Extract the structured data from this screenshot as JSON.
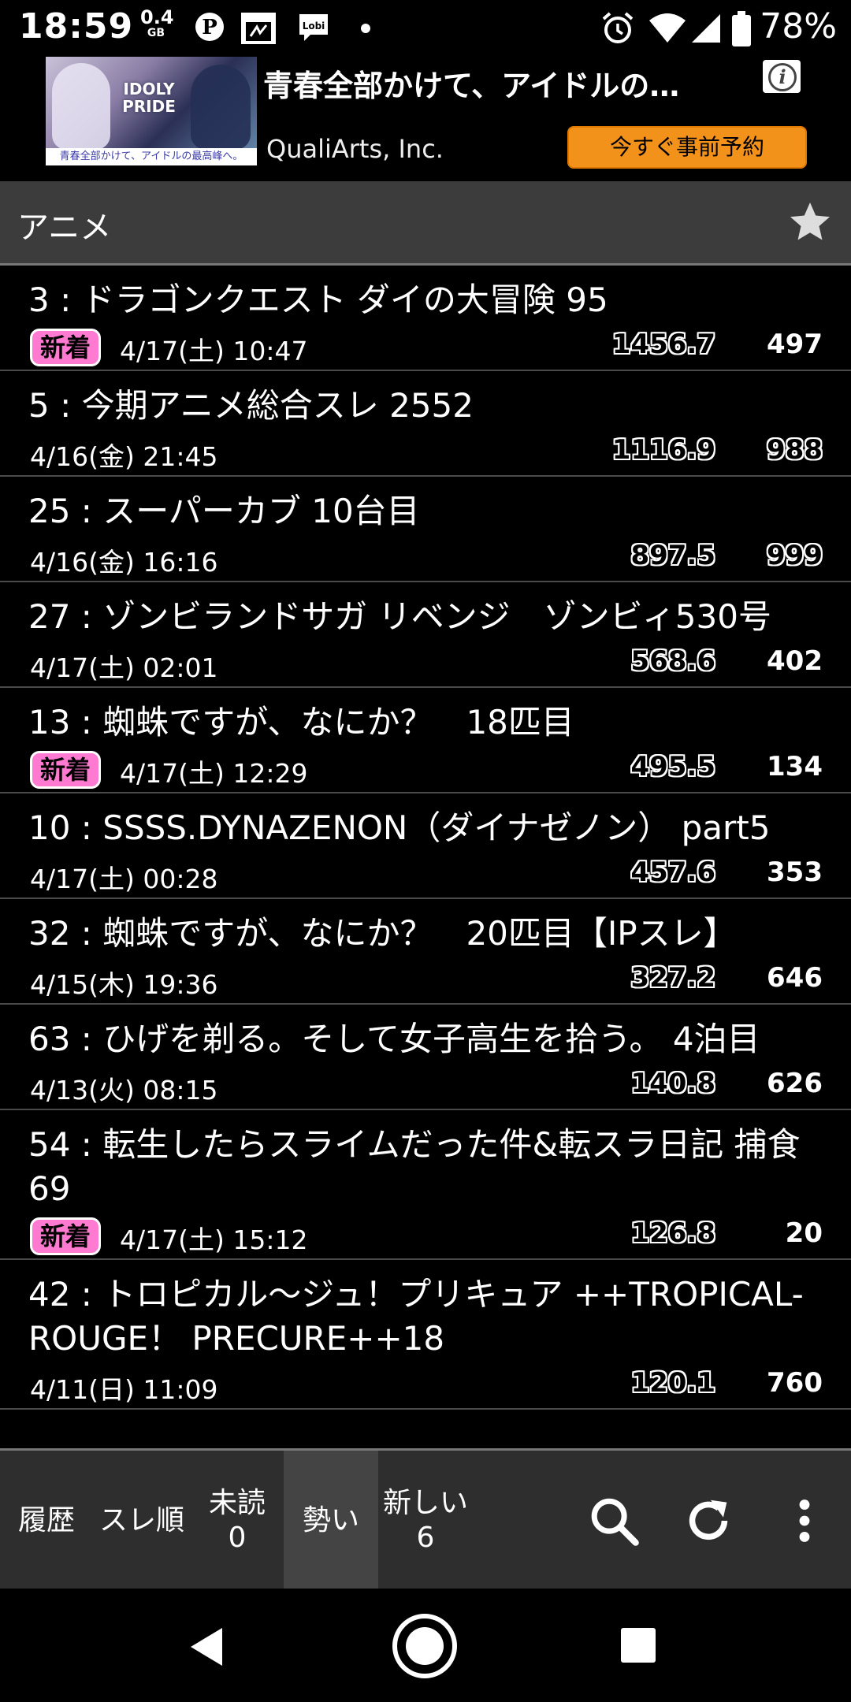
{
  "status": {
    "time": "18:59",
    "data_value": "0.4",
    "data_unit": "GB",
    "battery": "78%"
  },
  "ad": {
    "title": "青春全部かけて、アイドルの…",
    "company": "QualiArts, Inc.",
    "cta": "今すぐ事前予約",
    "image_logo": "IDOLY PRIDE",
    "image_caption": "青春全部かけて、アイドルの最高峰へ。"
  },
  "category": {
    "title": "アニメ"
  },
  "threads": [
    {
      "title": "3 : ドラゴンクエスト ダイの大冒険 95",
      "badge": "新着",
      "date": "4/17(土) 10:47",
      "momentum": "1456.7",
      "count": "497"
    },
    {
      "title": "5 : 今期アニメ総合スレ 2552",
      "badge": "",
      "date": "4/16(金) 21:45",
      "momentum": "1116.9",
      "count": "988"
    },
    {
      "title": "25 : スーパーカブ 10台目",
      "badge": "",
      "date": "4/16(金) 16:16",
      "momentum": "897.5",
      "count": "999"
    },
    {
      "title": "27 : ゾンビランドサガ リベンジ　ゾンビィ530号",
      "badge": "",
      "date": "4/17(土) 02:01",
      "momentum": "568.6",
      "count": "402"
    },
    {
      "title": "13 : 蜘蛛ですが、なにか？　18匹目",
      "badge": "新着",
      "date": "4/17(土) 12:29",
      "momentum": "495.5",
      "count": "134"
    },
    {
      "title": "10 : SSSS.DYNAZENON（ダイナゼノン） part5",
      "badge": "",
      "date": "4/17(土) 00:28",
      "momentum": "457.6",
      "count": "353"
    },
    {
      "title": "32 : 蜘蛛ですが、なにか？　20匹目【IPスレ】",
      "badge": "",
      "date": "4/15(木) 19:36",
      "momentum": "327.2",
      "count": "646"
    },
    {
      "title": "63 : ひげを剃る。そして女子高生を拾う。 4泊目",
      "badge": "",
      "date": "4/13(火) 08:15",
      "momentum": "140.8",
      "count": "626"
    },
    {
      "title": "54 : 転生したらスライムだった件&転スラ日記 捕食69",
      "badge": "新着",
      "date": "4/17(土) 15:12",
      "momentum": "126.8",
      "count": "20"
    },
    {
      "title": "42 : トロピカル～ジュ！プリキュア ++TROPICAL-ROUGE！ PRECURE++18",
      "badge": "",
      "date": "4/11(日) 11:09",
      "momentum": "120.1",
      "count": "760"
    }
  ],
  "tabs": {
    "history": "履歴",
    "thread_order": "スレ順",
    "unread_label": "未読",
    "unread_count": "0",
    "momentum": "勢い",
    "new_label": "新しい",
    "new_count": "6"
  },
  "colors": {
    "badge": "#ff7ad0",
    "ad_cta": "#f3921b",
    "header_bg": "#3c3c3c",
    "tabbar_bg": "#2e2e2e"
  }
}
